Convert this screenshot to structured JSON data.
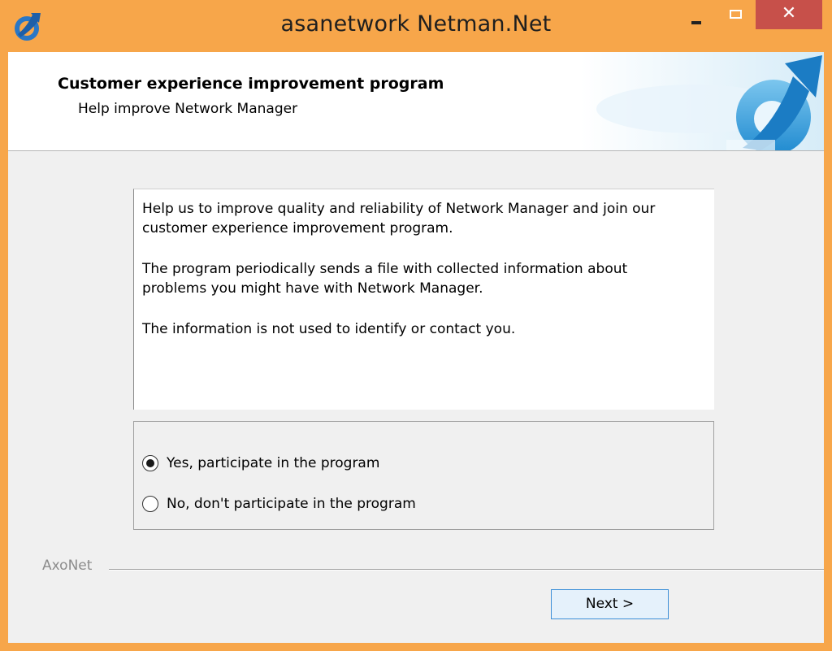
{
  "window": {
    "title": "asanetwork Netman.Net",
    "controls": {
      "minimize": "minimize",
      "maximize": "maximize",
      "close_glyph": "✕"
    },
    "accent_color": "#f7a64a",
    "close_color": "#c7504a"
  },
  "header": {
    "title": "Customer experience improvement program",
    "subtitle": "Help improve Network Manager",
    "art_icon": "logo-icon"
  },
  "info": {
    "paragraphs": [
      "Help us to improve quality and reliability of Network Manager and join our customer experience improvement program.",
      "The program periodically sends a file with collected information about problems you might have with Network Manager.",
      "The information is not used to identify or contact you."
    ]
  },
  "options": {
    "items": [
      {
        "label": "Yes, participate in the program",
        "selected": true
      },
      {
        "label": "No, don't participate in the program",
        "selected": false
      }
    ]
  },
  "footer": {
    "brand": "AxoNet",
    "next_label": "Next >"
  }
}
